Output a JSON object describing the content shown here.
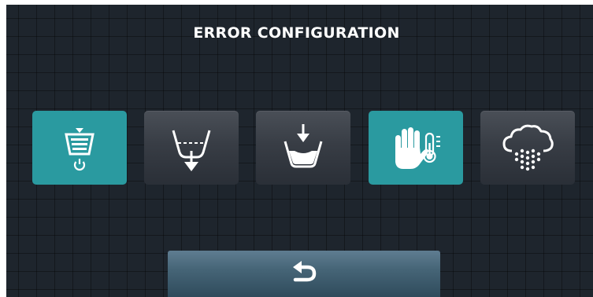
{
  "header": {
    "title": "ERROR CONFIGURATION"
  },
  "tiles": [
    {
      "icon": "drum-power-icon",
      "state": "selected"
    },
    {
      "icon": "drain-water-icon",
      "state": "normal"
    },
    {
      "icon": "fill-water-icon",
      "state": "normal"
    },
    {
      "icon": "hand-temperature-icon",
      "state": "selected"
    },
    {
      "icon": "steam-cloud-icon",
      "state": "normal"
    }
  ],
  "footer": {
    "back_icon": "back-arrow-icon"
  },
  "colors": {
    "selected": "#2a9aa0",
    "background": "#1e252d",
    "text": "#ffffff"
  }
}
